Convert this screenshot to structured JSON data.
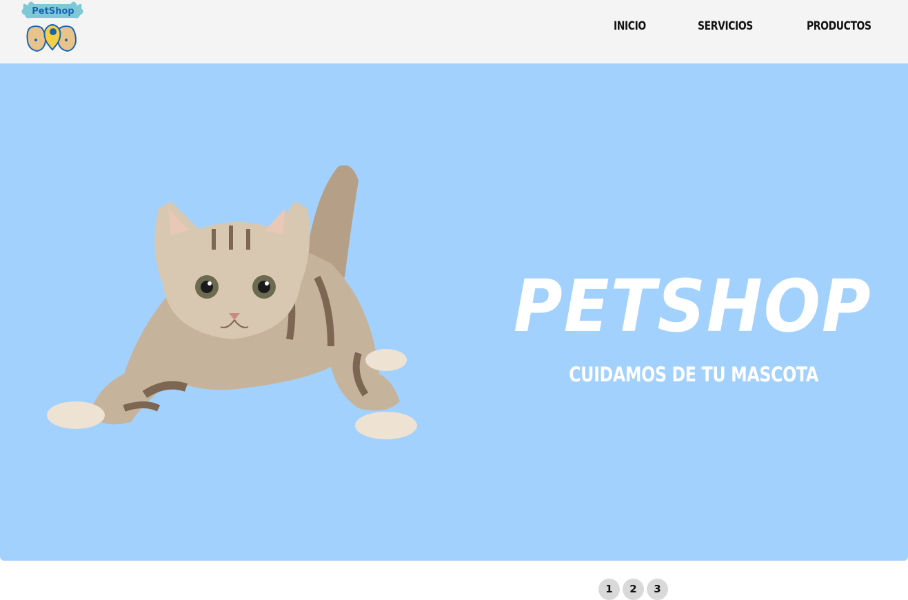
{
  "header": {
    "logo_text": "PetShop",
    "nav": [
      {
        "label": "INICIO"
      },
      {
        "label": "SERVICIOS"
      },
      {
        "label": "PRODUCTOS"
      }
    ]
  },
  "hero": {
    "title": "PETSHOP",
    "subtitle": "CUIDAMOS DE TU MASCOTA",
    "background_color": "#a3d1fd",
    "image": "kitten-photo"
  },
  "pagination": {
    "pages": [
      "1",
      "2",
      "3"
    ]
  },
  "colors": {
    "header_bg": "#f4f4f4",
    "hero_bg": "#a3d1fd",
    "logo_teal": "#7fc8d6",
    "logo_blue": "#1a64b5"
  }
}
